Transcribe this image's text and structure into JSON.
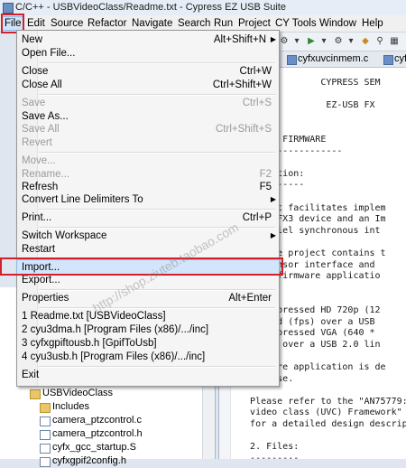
{
  "window": {
    "title": "C/C++ - USBVideoClass/Readme.txt - Cypress EZ USB Suite"
  },
  "menubar": {
    "items": [
      "File",
      "Edit",
      "Source",
      "Refactor",
      "Navigate",
      "Search",
      "Run",
      "Project",
      "CY Tools",
      "Window",
      "Help"
    ]
  },
  "editor_tabs": [
    {
      "label": "cyfxuvcinmem.c"
    },
    {
      "label": "cyf"
    }
  ],
  "editor_lines": [
    "                CYPRESS SEM",
    "",
    "                 EZ-USB FX",
    "",
    "",
    "     KIT FIRMWARE",
    "     ---------------",
    "",
    "   roduction:",
    "   ----------",
    "",
    "   roject facilitates implem",
    "   -USB FX3 device and an Im",
    "   parallel synchronous int",
    "",
    "   clipse project contains t",
    "   ge Sensor interface and",
    "   This firmware applicatio",
    "",
    "",
    "   Uncompressed HD 720p (12",
    "   second (fps) over a USB",
    "   Uncompressed VGA (640 *",
    "   (fps) over a USB 2.0 lin",
    "",
    "   irmware application is de",
    "   release.",
    "",
    "   Please refer to the \"AN75779: I",
    "   video class (UVC) Framework\" ap",
    "   for a detailed design descripti",
    "",
    "   2. Files:",
    "   ---------"
  ],
  "file_menu": {
    "items": [
      {
        "label": "New",
        "accel": "Alt+Shift+N",
        "submenu": true,
        "disabled": false
      },
      {
        "label": "Open File...",
        "accel": "",
        "submenu": false,
        "disabled": false
      },
      {
        "label": "Close",
        "accel": "Ctrl+W",
        "submenu": false,
        "disabled": false
      },
      {
        "label": "Close All",
        "accel": "Ctrl+Shift+W",
        "submenu": false,
        "disabled": false
      },
      {
        "label": "Save",
        "accel": "Ctrl+S",
        "submenu": false,
        "disabled": true
      },
      {
        "label": "Save As...",
        "accel": "",
        "submenu": false,
        "disabled": false
      },
      {
        "label": "Save All",
        "accel": "Ctrl+Shift+S",
        "submenu": false,
        "disabled": true
      },
      {
        "label": "Revert",
        "accel": "",
        "submenu": false,
        "disabled": true
      },
      {
        "label": "Move...",
        "accel": "",
        "submenu": false,
        "disabled": true
      },
      {
        "label": "Rename...",
        "accel": "F2",
        "submenu": false,
        "disabled": true
      },
      {
        "label": "Refresh",
        "accel": "F5",
        "submenu": false,
        "disabled": false
      },
      {
        "label": "Convert Line Delimiters To",
        "accel": "",
        "submenu": true,
        "disabled": false
      },
      {
        "label": "Print...",
        "accel": "Ctrl+P",
        "submenu": false,
        "disabled": false
      },
      {
        "label": "Switch Workspace",
        "accel": "",
        "submenu": true,
        "disabled": false
      },
      {
        "label": "Restart",
        "accel": "",
        "submenu": false,
        "disabled": false
      },
      {
        "label": "Import...",
        "accel": "",
        "submenu": false,
        "disabled": false,
        "selected": true
      },
      {
        "label": "Export...",
        "accel": "",
        "submenu": false,
        "disabled": false
      },
      {
        "label": "Properties",
        "accel": "Alt+Enter",
        "submenu": false,
        "disabled": false
      },
      {
        "label": "1 Readme.txt  [USBVideoClass]",
        "accel": "",
        "submenu": false,
        "disabled": false
      },
      {
        "label": "2 cyu3dma.h  [Program Files (x86)/.../inc]",
        "accel": "",
        "submenu": false,
        "disabled": false
      },
      {
        "label": "3 cyfxgpiftousb.h  [GpifToUsb]",
        "accel": "",
        "submenu": false,
        "disabled": false
      },
      {
        "label": "4 cyu3usb.h  [Program Files (x86)/.../inc]",
        "accel": "",
        "submenu": false,
        "disabled": false
      },
      {
        "label": "Exit",
        "accel": "",
        "submenu": false,
        "disabled": false
      }
    ]
  },
  "project_explorer": {
    "items": [
      {
        "label": "USBVideoClass",
        "type": "project"
      },
      {
        "label": "Includes",
        "type": "includes"
      },
      {
        "label": "camera_ptzcontrol.c",
        "type": "c-file"
      },
      {
        "label": "camera_ptzcontrol.h",
        "type": "h-file"
      },
      {
        "label": "cyfx_gcc_startup.S",
        "type": "s-file"
      },
      {
        "label": "cyfxgpif2config.h",
        "type": "h-file"
      }
    ]
  },
  "watermark": {
    "text": "http://shop.ziuteb.taobao.com"
  },
  "colors": {
    "highlight_box": "#d1202a",
    "menu_selection": "#d3e5fa"
  }
}
